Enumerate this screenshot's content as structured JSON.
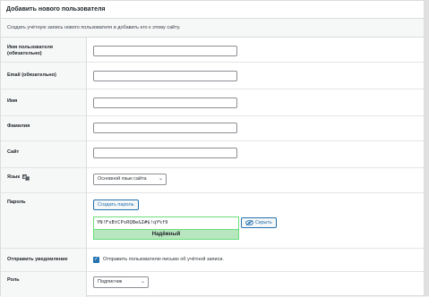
{
  "form": {
    "title": "Добавить нового пользователя",
    "description": "Создать учётную запись нового пользователя и добавить его к этому сайту."
  },
  "fields": {
    "username_label": "Имя пользователя (обязательно)",
    "email_label": "Email (обязательно)",
    "first_name_label": "Имя",
    "last_name_label": "Фамилия",
    "website_label": "Сайт",
    "language_label": "Язык",
    "language_icon": "translation-icon",
    "language_value": "Основной язык сайта",
    "password_label": "Пароль",
    "generate_password_button": "Создать пароль",
    "password_value": "YN!FsBtCPsRQBe&I#$!qY%f9",
    "hide_button": "Скрыть",
    "hide_icon": "eye-slash-icon",
    "strength_text": "Надёжный",
    "notify_label": "Отправить уведомление",
    "notify_checkbox_label": "Отправить пользователю письмо об учётной записи.",
    "notify_checked": true,
    "role_label": "Роль",
    "role_value": "Подписчик"
  },
  "colors": {
    "accent": "#2271b1",
    "strength_strong_bg": "#b8e6bf",
    "strength_strong_border": "#68de7c"
  }
}
